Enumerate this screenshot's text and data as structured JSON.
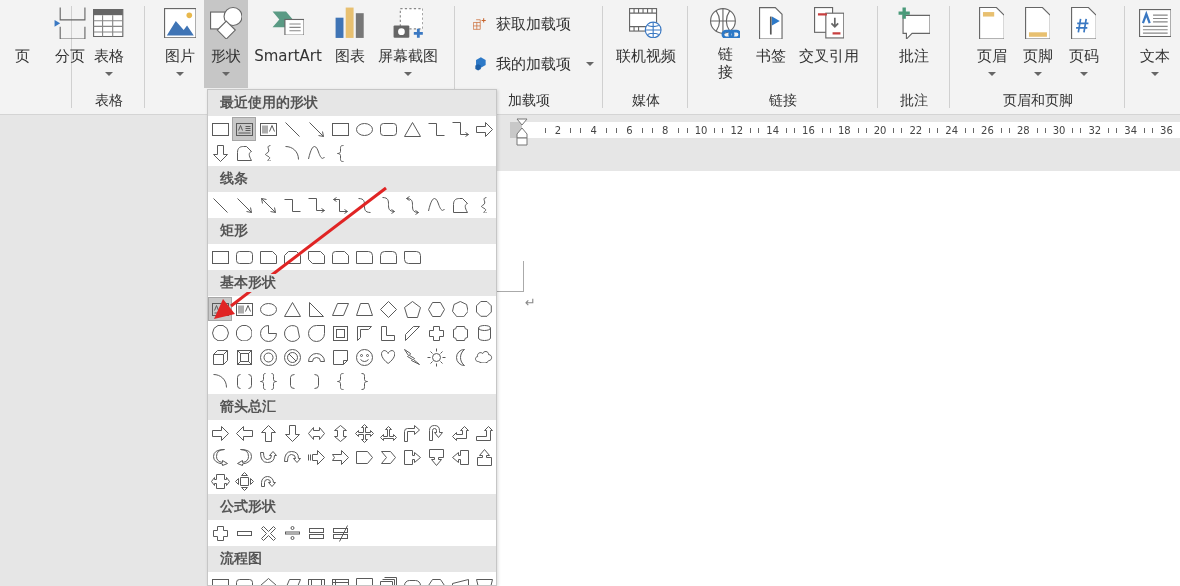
{
  "ribbon": {
    "groups": [
      {
        "buttons": [
          {
            "label": "页",
            "kind": "large",
            "has_menu": false,
            "selected": false
          },
          {
            "label": "分页",
            "kind": "large",
            "has_menu": false,
            "selected": false
          }
        ]
      },
      {
        "label": "表格",
        "buttons": [
          {
            "label": "表格",
            "kind": "large",
            "has_menu": true,
            "selected": false
          }
        ]
      },
      {
        "buttons": [
          {
            "label": "图片",
            "kind": "large",
            "has_menu": true,
            "selected": false
          },
          {
            "label": "形状",
            "kind": "large",
            "has_menu": true,
            "selected": true
          },
          {
            "label": "SmartArt",
            "kind": "large",
            "has_menu": false,
            "selected": false
          },
          {
            "label": "图表",
            "kind": "large",
            "has_menu": false,
            "selected": false
          },
          {
            "label": "屏幕截图",
            "kind": "large",
            "has_menu": true,
            "selected": false
          }
        ]
      },
      {
        "label": "加载项",
        "buttons": [
          {
            "label": "获取加载项",
            "kind": "small",
            "has_menu": false,
            "selected": false
          },
          {
            "label": "我的加载项",
            "kind": "small",
            "has_menu": true,
            "selected": false
          }
        ]
      },
      {
        "label": "媒体",
        "buttons": [
          {
            "label": "联机视频",
            "kind": "large",
            "has_menu": false,
            "selected": false
          }
        ]
      },
      {
        "label": "链接",
        "buttons": [
          {
            "label": "链接",
            "kind": "stacked",
            "has_menu": false,
            "selected": false
          },
          {
            "label": "书签",
            "kind": "large",
            "has_menu": false,
            "selected": false
          },
          {
            "label": "交叉引用",
            "kind": "large",
            "has_menu": false,
            "selected": false
          }
        ]
      },
      {
        "label": "批注",
        "buttons": [
          {
            "label": "批注",
            "kind": "large",
            "has_menu": false,
            "selected": false
          }
        ]
      },
      {
        "label": "页眉和页脚",
        "buttons": [
          {
            "label": "页眉",
            "kind": "large",
            "has_menu": true,
            "selected": false
          },
          {
            "label": "页脚",
            "kind": "large",
            "has_menu": true,
            "selected": false
          },
          {
            "label": "页码",
            "kind": "large",
            "has_menu": true,
            "selected": false
          }
        ]
      },
      {
        "buttons": [
          {
            "label": "文本",
            "kind": "large",
            "has_menu": true,
            "selected": false
          }
        ]
      }
    ]
  },
  "shapes_menu": {
    "sections": [
      {
        "title": "最近使用的形状",
        "shapes": [
          {
            "kind": "rectangle",
            "selected": false
          },
          {
            "kind": "text-box",
            "selected": true
          },
          {
            "kind": "vertical-text-box",
            "selected": false
          },
          {
            "kind": "line",
            "selected": false
          },
          {
            "kind": "arrow-line",
            "selected": false
          },
          {
            "kind": "rectangle",
            "selected": false
          },
          {
            "kind": "oval",
            "selected": false
          },
          {
            "kind": "rounded-rectangle",
            "selected": false
          },
          {
            "kind": "triangle",
            "selected": false
          },
          {
            "kind": "elbow-connector",
            "selected": false
          },
          {
            "kind": "elbow-arrow-connector",
            "selected": false
          },
          {
            "kind": "right-arrow",
            "selected": false
          },
          {
            "kind": "down-arrow",
            "selected": false
          },
          {
            "kind": "freeform",
            "selected": false
          },
          {
            "kind": "scribble",
            "selected": false
          },
          {
            "kind": "arc",
            "selected": false
          },
          {
            "kind": "curve",
            "selected": false
          },
          {
            "kind": "left-brace",
            "selected": false
          }
        ]
      },
      {
        "title": "线条",
        "shapes": [
          {
            "kind": "line",
            "selected": false
          },
          {
            "kind": "arrow-line",
            "selected": false
          },
          {
            "kind": "double-arrow-line",
            "selected": false
          },
          {
            "kind": "elbow-connector",
            "selected": false
          },
          {
            "kind": "elbow-arrow-connector",
            "selected": false
          },
          {
            "kind": "elbow-double-arrow-connector",
            "selected": false
          },
          {
            "kind": "curved-connector",
            "selected": false
          },
          {
            "kind": "curved-arrow-connector",
            "selected": false
          },
          {
            "kind": "curved-double-arrow-connector",
            "selected": false
          },
          {
            "kind": "curve",
            "selected": false
          },
          {
            "kind": "freeform",
            "selected": false
          },
          {
            "kind": "scribble",
            "selected": false
          }
        ]
      },
      {
        "title": "矩形",
        "shapes": [
          {
            "kind": "rectangle",
            "selected": false
          },
          {
            "kind": "rounded-rectangle",
            "selected": false
          },
          {
            "kind": "snip-corner-rectangle",
            "selected": false
          },
          {
            "kind": "snip-same-side-rectangle",
            "selected": false
          },
          {
            "kind": "snip-diagonal-rectangle",
            "selected": false
          },
          {
            "kind": "snip-round-rectangle",
            "selected": false
          },
          {
            "kind": "round-corner-rectangle",
            "selected": false
          },
          {
            "kind": "round-same-side-rectangle",
            "selected": false
          },
          {
            "kind": "round-diagonal-rectangle",
            "selected": false
          }
        ]
      },
      {
        "title": "基本形状",
        "shapes": [
          {
            "kind": "text-box",
            "selected": true
          },
          {
            "kind": "vertical-text-box",
            "selected": false
          },
          {
            "kind": "oval",
            "selected": false
          },
          {
            "kind": "triangle",
            "selected": false
          },
          {
            "kind": "right-triangle",
            "selected": false
          },
          {
            "kind": "parallelogram",
            "selected": false
          },
          {
            "kind": "trapezoid",
            "selected": false
          },
          {
            "kind": "diamond",
            "selected": false
          },
          {
            "kind": "pentagon",
            "selected": false
          },
          {
            "kind": "hexagon",
            "selected": false
          },
          {
            "kind": "heptagon",
            "selected": false
          },
          {
            "kind": "octagon",
            "selected": false
          },
          {
            "kind": "decagon",
            "selected": false
          },
          {
            "kind": "dodecagon",
            "selected": false
          },
          {
            "kind": "pie",
            "selected": false
          },
          {
            "kind": "chord",
            "selected": false
          },
          {
            "kind": "teardrop",
            "selected": false
          },
          {
            "kind": "frame",
            "selected": false
          },
          {
            "kind": "half-frame",
            "selected": false
          },
          {
            "kind": "l-shape",
            "selected": false
          },
          {
            "kind": "diagonal-stripe",
            "selected": false
          },
          {
            "kind": "cross",
            "selected": false
          },
          {
            "kind": "plaque",
            "selected": false
          },
          {
            "kind": "can",
            "selected": false
          },
          {
            "kind": "cube",
            "selected": false
          },
          {
            "kind": "bevel",
            "selected": false
          },
          {
            "kind": "donut",
            "selected": false
          },
          {
            "kind": "no-symbol",
            "selected": false
          },
          {
            "kind": "block-arc",
            "selected": false
          },
          {
            "kind": "folded-corner",
            "selected": false
          },
          {
            "kind": "smiley-face",
            "selected": false
          },
          {
            "kind": "heart",
            "selected": false
          },
          {
            "kind": "lightning-bolt",
            "selected": false
          },
          {
            "kind": "sun",
            "selected": false
          },
          {
            "kind": "moon",
            "selected": false
          },
          {
            "kind": "cloud",
            "selected": false
          },
          {
            "kind": "arc",
            "selected": false
          },
          {
            "kind": "double-bracket",
            "selected": false
          },
          {
            "kind": "double-brace",
            "selected": false
          },
          {
            "kind": "left-bracket",
            "selected": false
          },
          {
            "kind": "right-bracket",
            "selected": false
          },
          {
            "kind": "left-brace",
            "selected": false
          },
          {
            "kind": "right-brace",
            "selected": false
          }
        ]
      },
      {
        "title": "箭头总汇",
        "shapes": [
          {
            "kind": "right-arrow",
            "selected": false
          },
          {
            "kind": "left-arrow",
            "selected": false
          },
          {
            "kind": "up-arrow",
            "selected": false
          },
          {
            "kind": "down-arrow",
            "selected": false
          },
          {
            "kind": "left-right-arrow",
            "selected": false
          },
          {
            "kind": "up-down-arrow",
            "selected": false
          },
          {
            "kind": "quad-arrow",
            "selected": false
          },
          {
            "kind": "left-right-up-arrow",
            "selected": false
          },
          {
            "kind": "bent-arrow",
            "selected": false
          },
          {
            "kind": "u-turn-arrow",
            "selected": false
          },
          {
            "kind": "left-up-arrow",
            "selected": false
          },
          {
            "kind": "bent-up-arrow",
            "selected": false
          },
          {
            "kind": "curved-right-arrow",
            "selected": false
          },
          {
            "kind": "curved-left-arrow",
            "selected": false
          },
          {
            "kind": "curved-up-arrow",
            "selected": false
          },
          {
            "kind": "curved-down-arrow",
            "selected": false
          },
          {
            "kind": "striped-right-arrow",
            "selected": false
          },
          {
            "kind": "notched-right-arrow",
            "selected": false
          },
          {
            "kind": "pentagon-arrow",
            "selected": false
          },
          {
            "kind": "chevron",
            "selected": false
          },
          {
            "kind": "right-arrow-callout",
            "selected": false
          },
          {
            "kind": "down-arrow-callout",
            "selected": false
          },
          {
            "kind": "left-arrow-callout",
            "selected": false
          },
          {
            "kind": "up-arrow-callout",
            "selected": false
          },
          {
            "kind": "left-right-arrow-callout",
            "selected": false
          },
          {
            "kind": "quad-arrow-callout",
            "selected": false
          },
          {
            "kind": "circular-arrow",
            "selected": false
          }
        ]
      },
      {
        "title": "公式形状",
        "shapes": [
          {
            "kind": "plus",
            "selected": false
          },
          {
            "kind": "minus",
            "selected": false
          },
          {
            "kind": "multiply",
            "selected": false
          },
          {
            "kind": "divide",
            "selected": false
          },
          {
            "kind": "equal",
            "selected": false
          },
          {
            "kind": "not-equal",
            "selected": false
          }
        ]
      },
      {
        "title": "流程图",
        "shapes": [
          {
            "kind": "process",
            "selected": false
          },
          {
            "kind": "alternate-process",
            "selected": false
          },
          {
            "kind": "decision",
            "selected": false
          },
          {
            "kind": "data",
            "selected": false
          },
          {
            "kind": "predefined-process",
            "selected": false
          },
          {
            "kind": "internal-storage",
            "selected": false
          },
          {
            "kind": "document",
            "selected": false
          },
          {
            "kind": "multidocument",
            "selected": false
          },
          {
            "kind": "terminator",
            "selected": false
          },
          {
            "kind": "preparation",
            "selected": false
          },
          {
            "kind": "manual-input",
            "selected": false
          },
          {
            "kind": "manual-operation",
            "selected": false
          }
        ]
      }
    ]
  },
  "ruler": {
    "labels": [
      "2",
      "4",
      "6",
      "8",
      "10",
      "12",
      "14",
      "16",
      "18",
      "20",
      "22",
      "24",
      "26",
      "28",
      "30",
      "32",
      "34",
      "36"
    ]
  },
  "page": {
    "paragraph_mark": "↵"
  }
}
